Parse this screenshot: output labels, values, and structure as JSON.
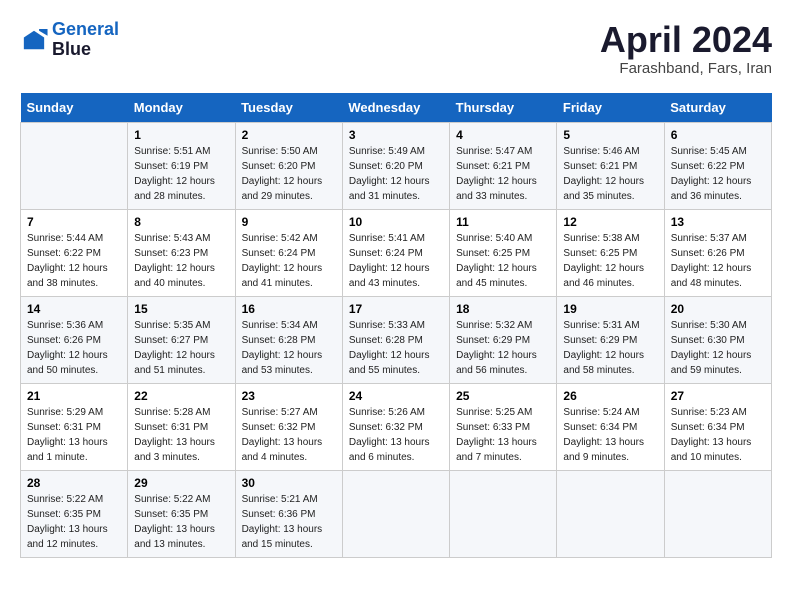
{
  "logo": {
    "line1": "General",
    "line2": "Blue"
  },
  "title": "April 2024",
  "subtitle": "Farashband, Fars, Iran",
  "header": {
    "days": [
      "Sunday",
      "Monday",
      "Tuesday",
      "Wednesday",
      "Thursday",
      "Friday",
      "Saturday"
    ]
  },
  "weeks": [
    {
      "cells": [
        {
          "day": null,
          "info": null
        },
        {
          "day": "1",
          "sunrise": "5:51 AM",
          "sunset": "6:19 PM",
          "daylight": "12 hours and 28 minutes."
        },
        {
          "day": "2",
          "sunrise": "5:50 AM",
          "sunset": "6:20 PM",
          "daylight": "12 hours and 29 minutes."
        },
        {
          "day": "3",
          "sunrise": "5:49 AM",
          "sunset": "6:20 PM",
          "daylight": "12 hours and 31 minutes."
        },
        {
          "day": "4",
          "sunrise": "5:47 AM",
          "sunset": "6:21 PM",
          "daylight": "12 hours and 33 minutes."
        },
        {
          "day": "5",
          "sunrise": "5:46 AM",
          "sunset": "6:21 PM",
          "daylight": "12 hours and 35 minutes."
        },
        {
          "day": "6",
          "sunrise": "5:45 AM",
          "sunset": "6:22 PM",
          "daylight": "12 hours and 36 minutes."
        }
      ]
    },
    {
      "cells": [
        {
          "day": "7",
          "sunrise": "5:44 AM",
          "sunset": "6:22 PM",
          "daylight": "12 hours and 38 minutes."
        },
        {
          "day": "8",
          "sunrise": "5:43 AM",
          "sunset": "6:23 PM",
          "daylight": "12 hours and 40 minutes."
        },
        {
          "day": "9",
          "sunrise": "5:42 AM",
          "sunset": "6:24 PM",
          "daylight": "12 hours and 41 minutes."
        },
        {
          "day": "10",
          "sunrise": "5:41 AM",
          "sunset": "6:24 PM",
          "daylight": "12 hours and 43 minutes."
        },
        {
          "day": "11",
          "sunrise": "5:40 AM",
          "sunset": "6:25 PM",
          "daylight": "12 hours and 45 minutes."
        },
        {
          "day": "12",
          "sunrise": "5:38 AM",
          "sunset": "6:25 PM",
          "daylight": "12 hours and 46 minutes."
        },
        {
          "day": "13",
          "sunrise": "5:37 AM",
          "sunset": "6:26 PM",
          "daylight": "12 hours and 48 minutes."
        }
      ]
    },
    {
      "cells": [
        {
          "day": "14",
          "sunrise": "5:36 AM",
          "sunset": "6:26 PM",
          "daylight": "12 hours and 50 minutes."
        },
        {
          "day": "15",
          "sunrise": "5:35 AM",
          "sunset": "6:27 PM",
          "daylight": "12 hours and 51 minutes."
        },
        {
          "day": "16",
          "sunrise": "5:34 AM",
          "sunset": "6:28 PM",
          "daylight": "12 hours and 53 minutes."
        },
        {
          "day": "17",
          "sunrise": "5:33 AM",
          "sunset": "6:28 PM",
          "daylight": "12 hours and 55 minutes."
        },
        {
          "day": "18",
          "sunrise": "5:32 AM",
          "sunset": "6:29 PM",
          "daylight": "12 hours and 56 minutes."
        },
        {
          "day": "19",
          "sunrise": "5:31 AM",
          "sunset": "6:29 PM",
          "daylight": "12 hours and 58 minutes."
        },
        {
          "day": "20",
          "sunrise": "5:30 AM",
          "sunset": "6:30 PM",
          "daylight": "12 hours and 59 minutes."
        }
      ]
    },
    {
      "cells": [
        {
          "day": "21",
          "sunrise": "5:29 AM",
          "sunset": "6:31 PM",
          "daylight": "13 hours and 1 minute."
        },
        {
          "day": "22",
          "sunrise": "5:28 AM",
          "sunset": "6:31 PM",
          "daylight": "13 hours and 3 minutes."
        },
        {
          "day": "23",
          "sunrise": "5:27 AM",
          "sunset": "6:32 PM",
          "daylight": "13 hours and 4 minutes."
        },
        {
          "day": "24",
          "sunrise": "5:26 AM",
          "sunset": "6:32 PM",
          "daylight": "13 hours and 6 minutes."
        },
        {
          "day": "25",
          "sunrise": "5:25 AM",
          "sunset": "6:33 PM",
          "daylight": "13 hours and 7 minutes."
        },
        {
          "day": "26",
          "sunrise": "5:24 AM",
          "sunset": "6:34 PM",
          "daylight": "13 hours and 9 minutes."
        },
        {
          "day": "27",
          "sunrise": "5:23 AM",
          "sunset": "6:34 PM",
          "daylight": "13 hours and 10 minutes."
        }
      ]
    },
    {
      "cells": [
        {
          "day": "28",
          "sunrise": "5:22 AM",
          "sunset": "6:35 PM",
          "daylight": "13 hours and 12 minutes."
        },
        {
          "day": "29",
          "sunrise": "5:22 AM",
          "sunset": "6:35 PM",
          "daylight": "13 hours and 13 minutes."
        },
        {
          "day": "30",
          "sunrise": "5:21 AM",
          "sunset": "6:36 PM",
          "daylight": "13 hours and 15 minutes."
        },
        {
          "day": null,
          "info": null
        },
        {
          "day": null,
          "info": null
        },
        {
          "day": null,
          "info": null
        },
        {
          "day": null,
          "info": null
        }
      ]
    }
  ]
}
